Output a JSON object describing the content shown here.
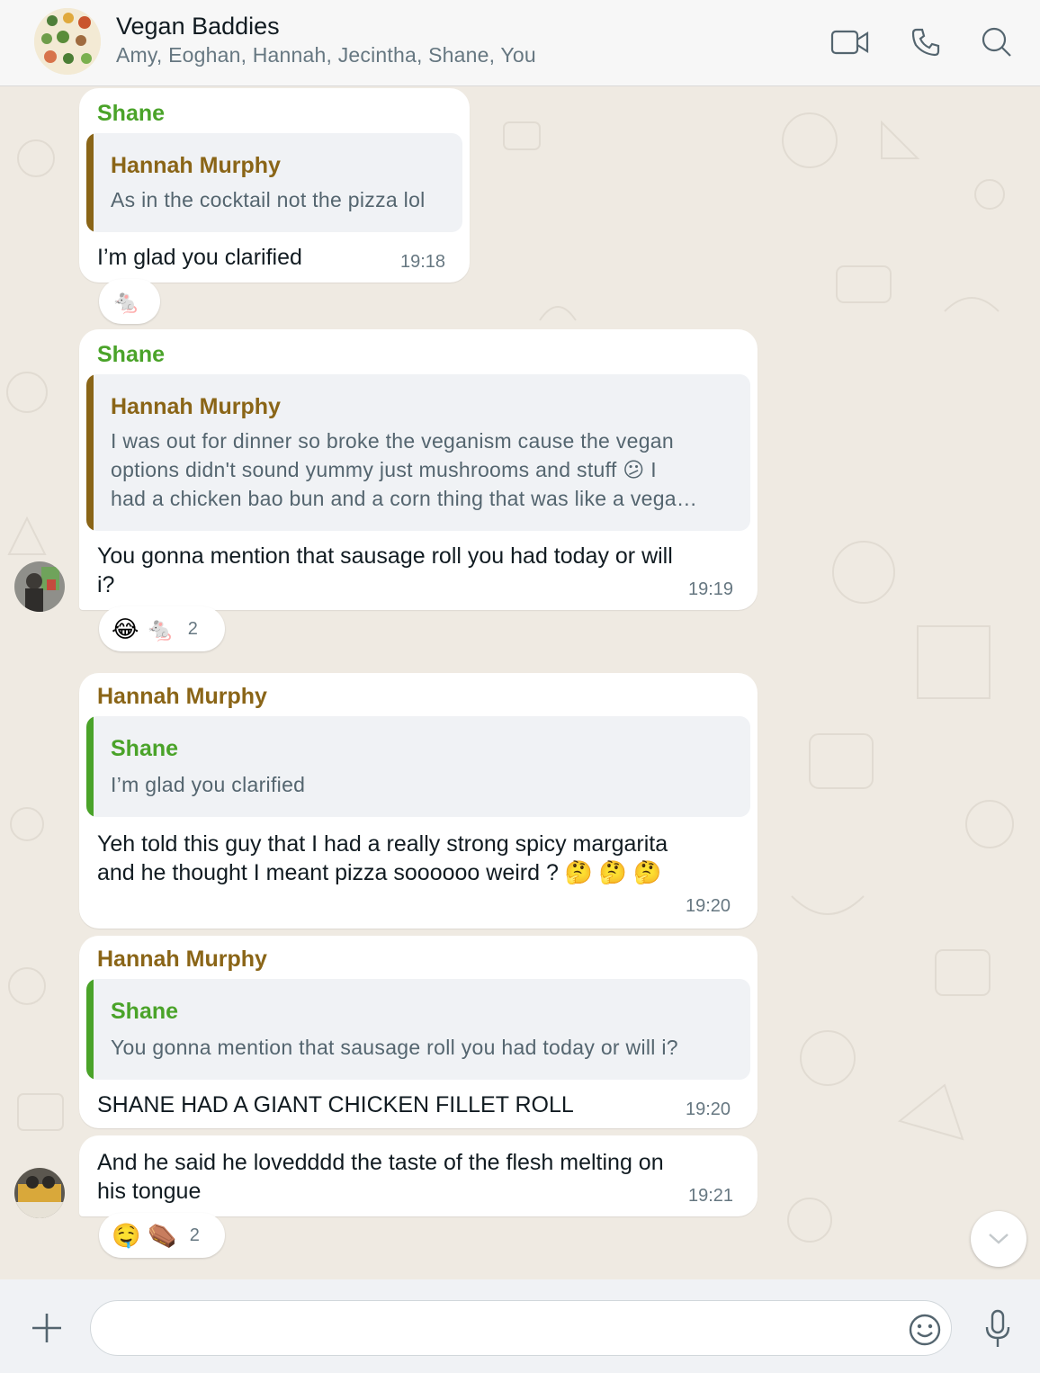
{
  "header": {
    "title": "Vegan Baddies",
    "members": "Amy, Eoghan, Hannah, Jecintha, Shane, You",
    "icons": [
      "video-call-icon",
      "voice-call-icon",
      "search-icon"
    ]
  },
  "messages": [
    {
      "sender": "Shane",
      "quote": {
        "name": "Hannah Murphy",
        "text": "As in the cocktail not the pizza lol"
      },
      "text": "I’m glad you clarified",
      "time": "19:18",
      "reactions": {
        "emojis": [
          "🐁"
        ],
        "count": ""
      }
    },
    {
      "sender": "Shane",
      "quote": {
        "name": "Hannah Murphy",
        "lines": [
          "I was out for dinner so broke the veganism cause the vegan",
          "options didn't sound yummy just mushrooms and stuff 😕 I",
          "had a chicken bao bun and a corn thing that was like a vega…"
        ]
      },
      "lines": [
        "You gonna mention that sausage roll you had today or will",
        "i?"
      ],
      "time": "19:19",
      "reactions": {
        "emojis": [
          "😂",
          "🐁"
        ],
        "count": "2"
      }
    },
    {
      "sender": "Hannah Murphy",
      "quote": {
        "name": "Shane",
        "text": "I’m glad you clarified"
      },
      "lines": [
        "Yeh told this guy that I had a really strong spicy margarita",
        "and he thought I meant pizza soooooo weird ? 🤔 🤔 🤔"
      ],
      "time": "19:20"
    },
    {
      "sender": "Hannah Murphy",
      "quote": {
        "name": "Shane",
        "text": "You gonna mention that sausage roll you had today or will i?"
      },
      "text": "SHANE HAD A GIANT CHICKEN FILLET ROLL",
      "time": "19:20"
    },
    {
      "lines": [
        "And he said he lovedddd the taste of the flesh melting on",
        "his tongue"
      ],
      "time": "19:21",
      "reactions": {
        "emojis": [
          "🤤",
          "⚰️"
        ],
        "count": "2"
      }
    }
  ],
  "composer": {
    "placeholder": ""
  },
  "colors": {
    "shane": "#4aa329",
    "hannah": "#8a6517",
    "chat_bg": "#efeae2"
  }
}
